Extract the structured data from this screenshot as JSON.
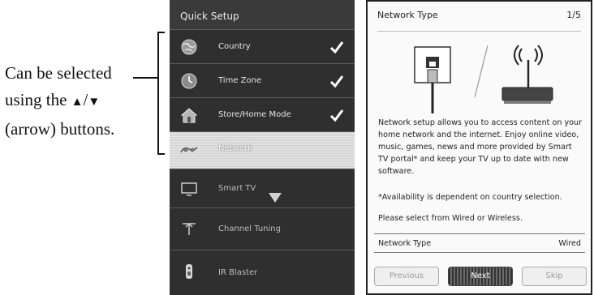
{
  "annotation": {
    "line1": "Can be selected",
    "line2_prefix": "using the ",
    "up_arrow": "▲",
    "separator": "/",
    "down_arrow": "▼",
    "line3": "(arrow) buttons."
  },
  "menu": {
    "title": "Quick Setup",
    "items": [
      {
        "label": "Country",
        "icon": "globe-icon",
        "checked": true
      },
      {
        "label": "Time Zone",
        "icon": "clock-icon",
        "checked": true
      },
      {
        "label": "Store/Home Mode",
        "icon": "house-icon",
        "checked": true
      },
      {
        "label": "Network",
        "icon": "network-icon",
        "checked": false,
        "selected": true
      },
      {
        "label": "Smart TV",
        "icon": "tv-icon",
        "checked": false
      },
      {
        "label": "Channel Tuning",
        "icon": "antenna-icon",
        "checked": false
      },
      {
        "label": "IR Blaster",
        "icon": "remote-icon",
        "checked": false
      }
    ]
  },
  "info": {
    "title": "Network Type",
    "page": "1/5",
    "body": "Network setup allows you to access content on your home network and the internet. Enjoy online video, music, games, news and more provided by Smart TV portal* and keep your TV up to date with new software.",
    "note": "*Availability is dependent on country selection.",
    "prompt": "Please select from Wired or Wireless.",
    "setting_label": "Network Type",
    "setting_value": "Wired",
    "buttons": {
      "previous": "Previous",
      "next": "Next",
      "skip": "Skip"
    }
  },
  "colors": {
    "menu_bg": "#2b2b2b",
    "selected_bg": "#e0e0e0",
    "check": "#ffffff"
  }
}
